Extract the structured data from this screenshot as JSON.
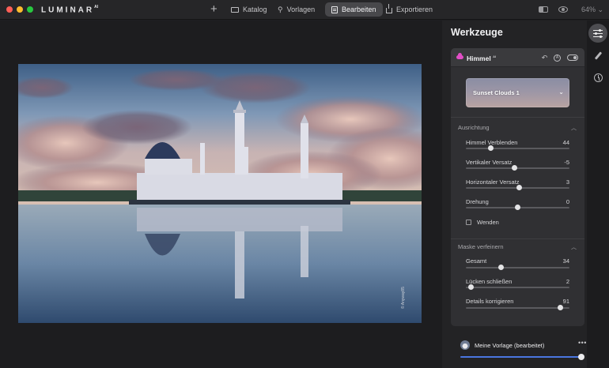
{
  "app": {
    "logo": "LUMINAR",
    "logo_badge": "AI",
    "zoom": "64%"
  },
  "nav": {
    "add": "+",
    "items": [
      {
        "label": "Katalog",
        "icon": "folder-icon",
        "active": false
      },
      {
        "label": "Vorlagen",
        "icon": "magic-wand-icon",
        "active": false
      },
      {
        "label": "Bearbeiten",
        "icon": "edit-icon",
        "active": true
      },
      {
        "label": "Exportieren",
        "icon": "share-icon",
        "active": false
      }
    ]
  },
  "photo": {
    "watermark": "© Anyway85"
  },
  "panel": {
    "title": "Werkzeuge",
    "tool": {
      "title": "Himmel",
      "badge": "AI",
      "preset": "Sunset Clouds 1",
      "accent_color": "#e24ec6"
    },
    "ausrichtung": {
      "title": "Ausrichtung",
      "sliders": [
        {
          "label": "Himmel Verblenden",
          "value": "44",
          "fraction": 0.24
        },
        {
          "label": "Vertikaler Versatz",
          "value": "-5",
          "fraction": 0.47
        },
        {
          "label": "Horizontaler Versatz",
          "value": "3",
          "fraction": 0.515
        },
        {
          "label": "Drehung",
          "value": "0",
          "fraction": 0.5
        }
      ],
      "checkbox": {
        "label": "Wenden",
        "checked": false
      }
    },
    "maske": {
      "title": "Maske verfeinern",
      "sliders": [
        {
          "label": "Gesamt",
          "value": "34",
          "fraction": 0.34
        },
        {
          "label": "Lücken schließen",
          "value": "2",
          "fraction": 0.05
        },
        {
          "label": "Details korrigieren",
          "value": "91",
          "fraction": 0.91
        }
      ]
    }
  },
  "preset_bar": {
    "label": "Meine Vorlage (bearbeitet)",
    "more": "•••",
    "amount": 0.99,
    "accent_color": "#4a76e0"
  }
}
